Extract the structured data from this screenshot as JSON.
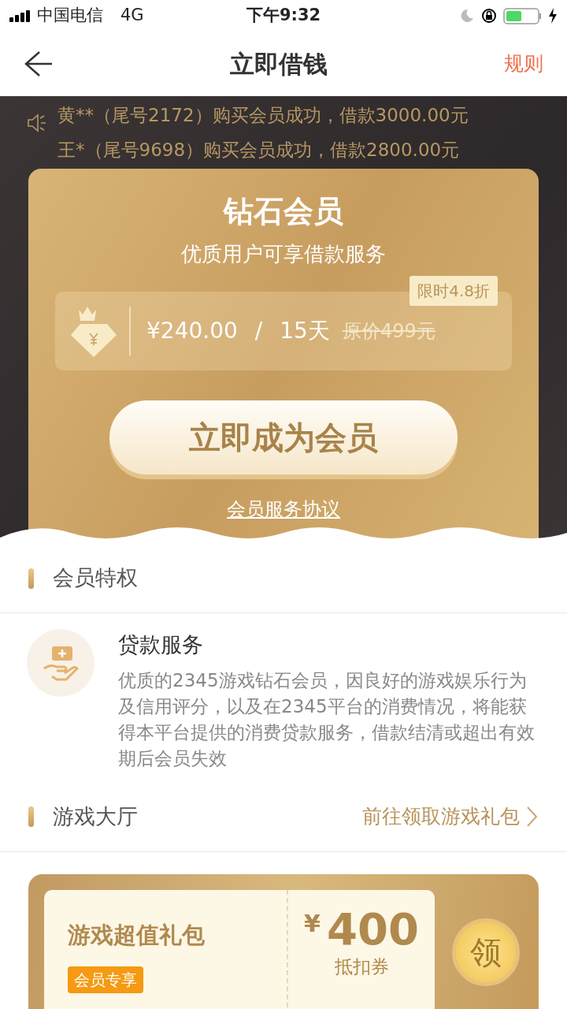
{
  "status_bar": {
    "carrier": "中国电信",
    "network": "4G",
    "time": "下午9:32"
  },
  "header": {
    "title": "立即借钱",
    "action": "规则"
  },
  "ticker": [
    "黄**（尾号2172）购买会员成功，借款3000.00元",
    "王*（尾号9698）购买会员成功，借款2800.00元"
  ],
  "membership": {
    "title": "钻石会员",
    "subtitle": "优质用户可享借款服务",
    "price": "¥240.00",
    "separator": "/",
    "duration": "15天",
    "original_price": "原价499元",
    "discount_tag": "限时4.8折",
    "button": "立即成为会员",
    "agreement_link": "会员服务协议"
  },
  "privileges": {
    "heading": "会员特权",
    "items": [
      {
        "title": "贷款服务",
        "description": "优质的2345游戏钻石会员，因良好的游戏娱乐行为及信用评分，以及在2345平台的消费情况，将能获得本平台提供的消费贷款服务，借款结清或超出有效期后会员失效"
      }
    ]
  },
  "game_hall": {
    "heading": "游戏大厅",
    "link": "前往领取游戏礼包"
  },
  "gift": {
    "title": "游戏超值礼包",
    "badge": "会员专享",
    "currency": "¥",
    "amount": "400",
    "unit": "抵扣券",
    "claim": "领"
  }
}
